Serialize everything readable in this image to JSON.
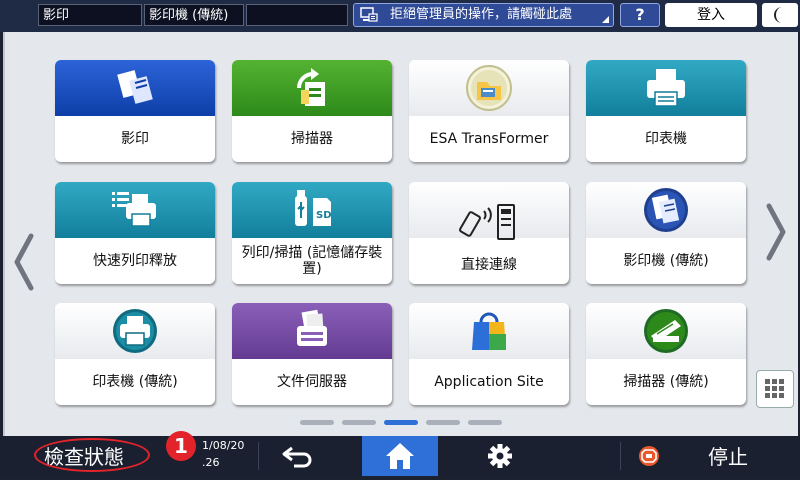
{
  "topbar": {
    "field1": "影印",
    "field2": "影印機 (傳統)",
    "field3": "",
    "message": "拒絕管理員的操作，請觸碰此處",
    "help_label": "?",
    "login_label": "登入"
  },
  "tiles": [
    {
      "label": "影印",
      "icon": "copier-icon"
    },
    {
      "label": "掃描器",
      "icon": "scanner-icon"
    },
    {
      "label": "ESA TransFormer",
      "icon": "esa-transformer-icon"
    },
    {
      "label": "印表機",
      "icon": "printer-icon"
    },
    {
      "label": "快速列印釋放",
      "icon": "quick-print-release-icon"
    },
    {
      "label": "列印/掃描 (記憶儲存裝置)",
      "icon": "memory-storage-icon"
    },
    {
      "label": "直接連線",
      "icon": "direct-connection-icon"
    },
    {
      "label": "影印機 (傳統)",
      "icon": "copier-classic-icon"
    },
    {
      "label": "印表機 (傳統)",
      "icon": "printer-classic-icon"
    },
    {
      "label": "文件伺服器",
      "icon": "document-server-icon"
    },
    {
      "label": "Application Site",
      "icon": "application-site-icon"
    },
    {
      "label": "掃描器 (傳統)",
      "icon": "scanner-classic-icon"
    }
  ],
  "pager": {
    "pages": 5,
    "active_index": 2
  },
  "bottombar": {
    "status_label": "檢查狀態",
    "badge": "1",
    "date_fragment": "1/08/20",
    "time_fragment": ".26",
    "stop_label": "停止"
  },
  "colors": {
    "accent_blue": "#2f6fd8",
    "badge_red": "#e3232a"
  }
}
